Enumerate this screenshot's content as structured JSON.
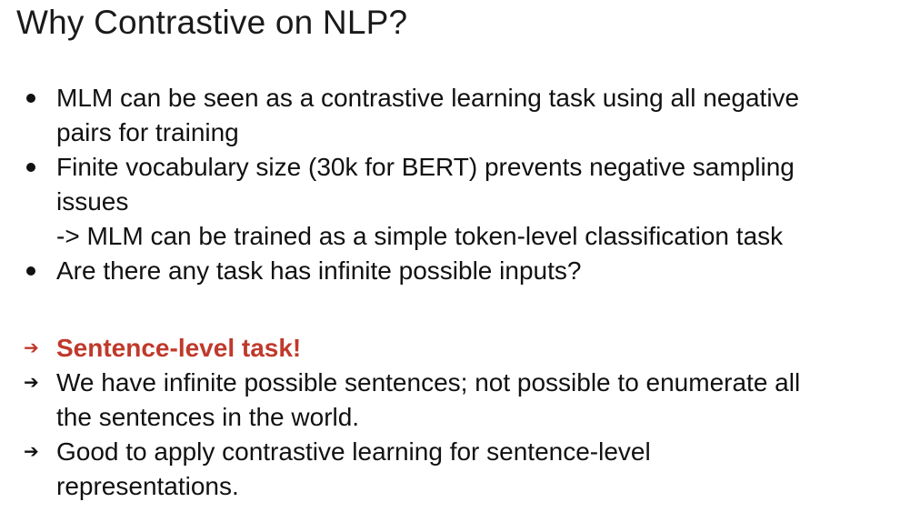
{
  "slide": {
    "title": "Why Contrastive on NLP?",
    "bullets": [
      {
        "lines": [
          "MLM can be seen as a contrastive learning task using all negative",
          "pairs for training"
        ]
      },
      {
        "lines": [
          "Finite vocabulary size (30k for BERT) prevents negative sampling",
          "issues",
          "-> MLM can be trained as a simple token-level classification task"
        ]
      },
      {
        "lines": [
          "Are there any task has infinite possible inputs?"
        ]
      }
    ],
    "arrows": [
      {
        "lines": [
          "Sentence-level task!"
        ],
        "highlight": true
      },
      {
        "lines": [
          "We have infinite possible sentences; not possible to enumerate all",
          "the sentences in the world."
        ]
      },
      {
        "lines": [
          "Good to apply contrastive learning for sentence-level",
          "representations."
        ]
      }
    ],
    "arrow_glyph": "➔",
    "highlight_color": "#c0392b"
  }
}
